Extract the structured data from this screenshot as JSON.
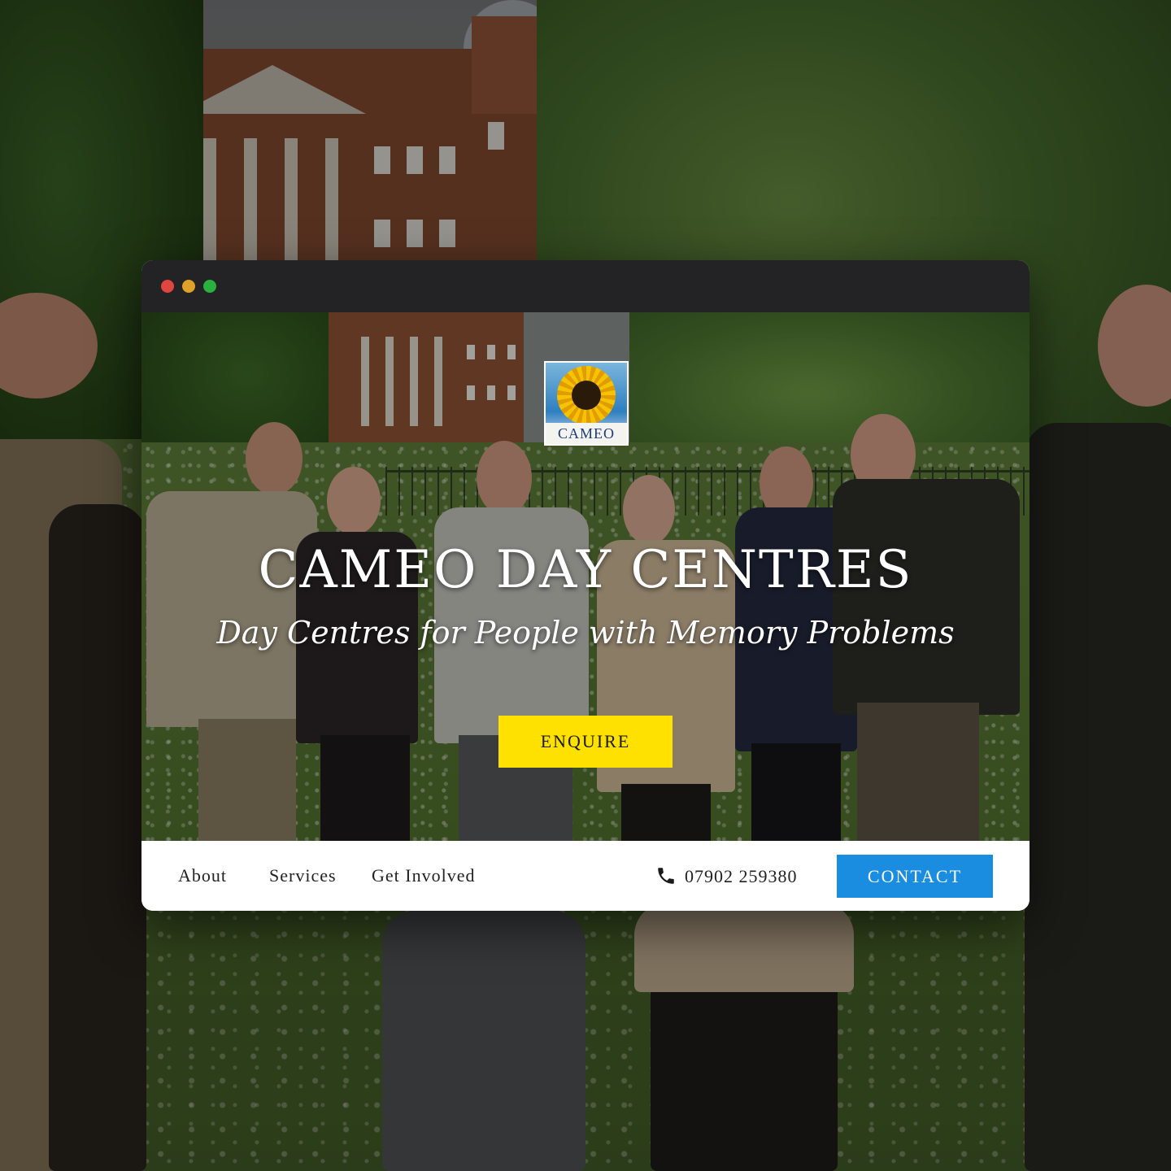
{
  "brand": {
    "logo_text": "CAMEO",
    "accent_yellow": "#ffe100",
    "accent_blue": "#1a8de0"
  },
  "hero": {
    "title": "CAMEO DAY CENTRES",
    "subtitle": "Day Centres for People with Memory Problems",
    "cta_label": "ENQUIRE"
  },
  "nav": {
    "links": [
      "About",
      "Services",
      "Get Involved"
    ],
    "phone_icon": "phone-icon",
    "phone": "07902 259380",
    "contact_label": "CONTACT"
  },
  "window": {
    "controls": [
      "close",
      "minimize",
      "maximize"
    ]
  }
}
